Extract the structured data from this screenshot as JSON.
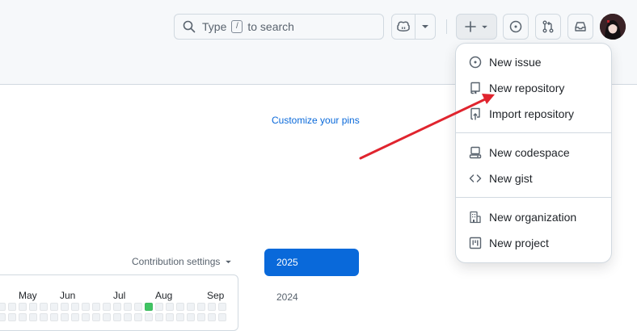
{
  "header": {
    "search": {
      "prefix": "Type",
      "key": "/",
      "suffix": "to search"
    }
  },
  "menu": {
    "items": [
      {
        "label": "New issue",
        "icon": "issue-opened-icon"
      },
      {
        "label": "New repository",
        "icon": "repo-icon"
      },
      {
        "label": "Import repository",
        "icon": "repo-push-icon"
      },
      {
        "label": "New codespace",
        "icon": "codespaces-icon"
      },
      {
        "label": "New gist",
        "icon": "code-icon"
      },
      {
        "label": "New organization",
        "icon": "organization-icon"
      },
      {
        "label": "New project",
        "icon": "project-icon"
      }
    ]
  },
  "profile": {
    "customize_pins": "Customize your pins",
    "contribution_settings": "Contribution settings",
    "years": [
      "2025",
      "2024"
    ],
    "months": [
      "May",
      "Jun",
      "Jul",
      "Aug",
      "Sep"
    ]
  },
  "colors": {
    "accent": "#0969da",
    "annotation_arrow": "#e0242e",
    "contribution_green": "#40c463"
  }
}
